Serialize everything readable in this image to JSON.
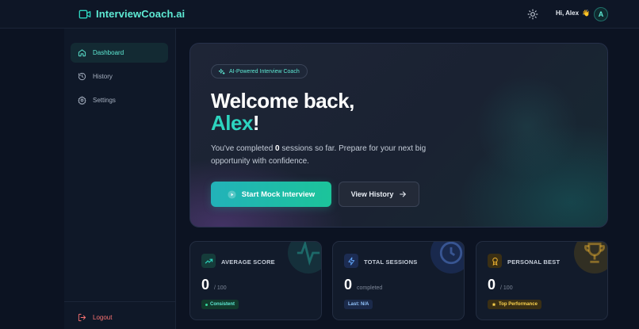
{
  "header": {
    "brand": "InterviewCoach.ai",
    "greeting": "Hi, Alex",
    "greeting_emoji": "👋",
    "avatar_initial": "A",
    "icons": [
      "video-camera-icon",
      "sun-icon"
    ]
  },
  "sidebar": {
    "items": [
      {
        "label": "Dashboard",
        "icon": "home-icon",
        "active": true
      },
      {
        "label": "History",
        "icon": "history-icon",
        "active": false
      },
      {
        "label": "Settings",
        "icon": "gear-icon",
        "active": false
      }
    ],
    "logout_label": "Logout"
  },
  "hero": {
    "badge": "AI-Powered Interview Coach",
    "title_line1": "Welcome back,",
    "title_name": "Alex",
    "title_suffix": "!",
    "desc_prefix": "You've completed ",
    "desc_count": "0",
    "desc_suffix": " sessions so far. Prepare for your next big opportunity with confidence.",
    "primary_button": "Start Mock Interview",
    "secondary_button": "View History"
  },
  "stats": [
    {
      "title": "AVERAGE SCORE",
      "value": "0",
      "unit": "/ 100",
      "badge": "Consistent",
      "icon": "trending-up-icon"
    },
    {
      "title": "TOTAL SESSIONS",
      "value": "0",
      "unit": "completed",
      "badge": "Last: N/A",
      "icon": "lightning-icon"
    },
    {
      "title": "PERSONAL BEST",
      "value": "0",
      "unit": "/ 100",
      "badge": "Top Performance",
      "badge_icon": "star-icon",
      "icon": "award-icon"
    }
  ],
  "colors": {
    "accent": "#2dd4bf",
    "background": "#0c1322",
    "danger": "#f87171",
    "gold": "#f5b731"
  }
}
